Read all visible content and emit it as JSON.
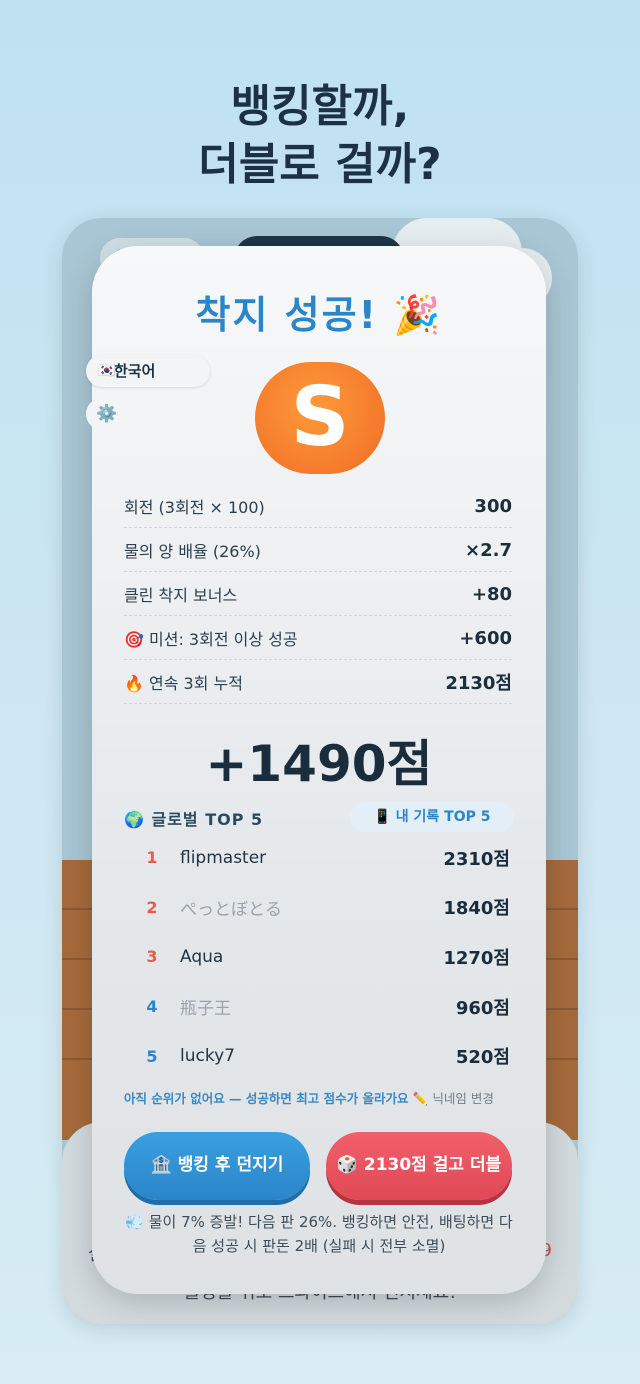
{
  "headline": {
    "line1": "뱅킹할까,",
    "line2": "더블로 걸까?"
  },
  "background": {
    "bank_icon": "🏦",
    "bottom_text": "물병을 위로 스와이프해서 던지세요!",
    "peek_left": "실",
    "peek_right": "9"
  },
  "language": {
    "flag": "🇰🇷",
    "label": "한국어"
  },
  "settings": {
    "icon": "⚙️"
  },
  "result": {
    "title": "착지 성공! 🎉",
    "grade": "S",
    "rows": [
      {
        "label": "회전 (3회전 × 100)",
        "value": "300"
      },
      {
        "label": "물의 양 배율 (26%)",
        "value": "×2.7"
      },
      {
        "label": "클린 착지 보너스",
        "value": "+80"
      },
      {
        "label": "🎯 미션: 3회전 이상 성공",
        "value": "+600"
      },
      {
        "label": "🔥 연속 3회 누적",
        "value": "2130점"
      }
    ],
    "total": "+1490점"
  },
  "leaderboard": {
    "title": "🌍 글로벌 TOP 5",
    "tab_mine": "📱 내 기록 TOP 5",
    "entries": [
      {
        "rank": "1",
        "name": "flipmaster",
        "score": "2310점"
      },
      {
        "rank": "2",
        "name": "ぺっとぼとる",
        "score": "1840점"
      },
      {
        "rank": "3",
        "name": "Aqua",
        "score": "1270점"
      },
      {
        "rank": "4",
        "name": "瓶子王",
        "score": "960점"
      },
      {
        "rank": "5",
        "name": "lucky7",
        "score": "520점"
      }
    ],
    "hint": "아직 순위가 없어요 — 성공하면 최고 점수가 올라가요",
    "edit_nickname": "✏️ 닉네임 변경"
  },
  "actions": {
    "bank_label": "🏦 뱅킹 후 던지기",
    "double_label": "🎲 2130점 걸고 더블"
  },
  "description": "💨 물이 7% 증발! 다음 판 26%. 뱅킹하면 안전, 배팅하면 다음 성공 시 판돈 2배 (실패 시 전부 소멸)"
}
